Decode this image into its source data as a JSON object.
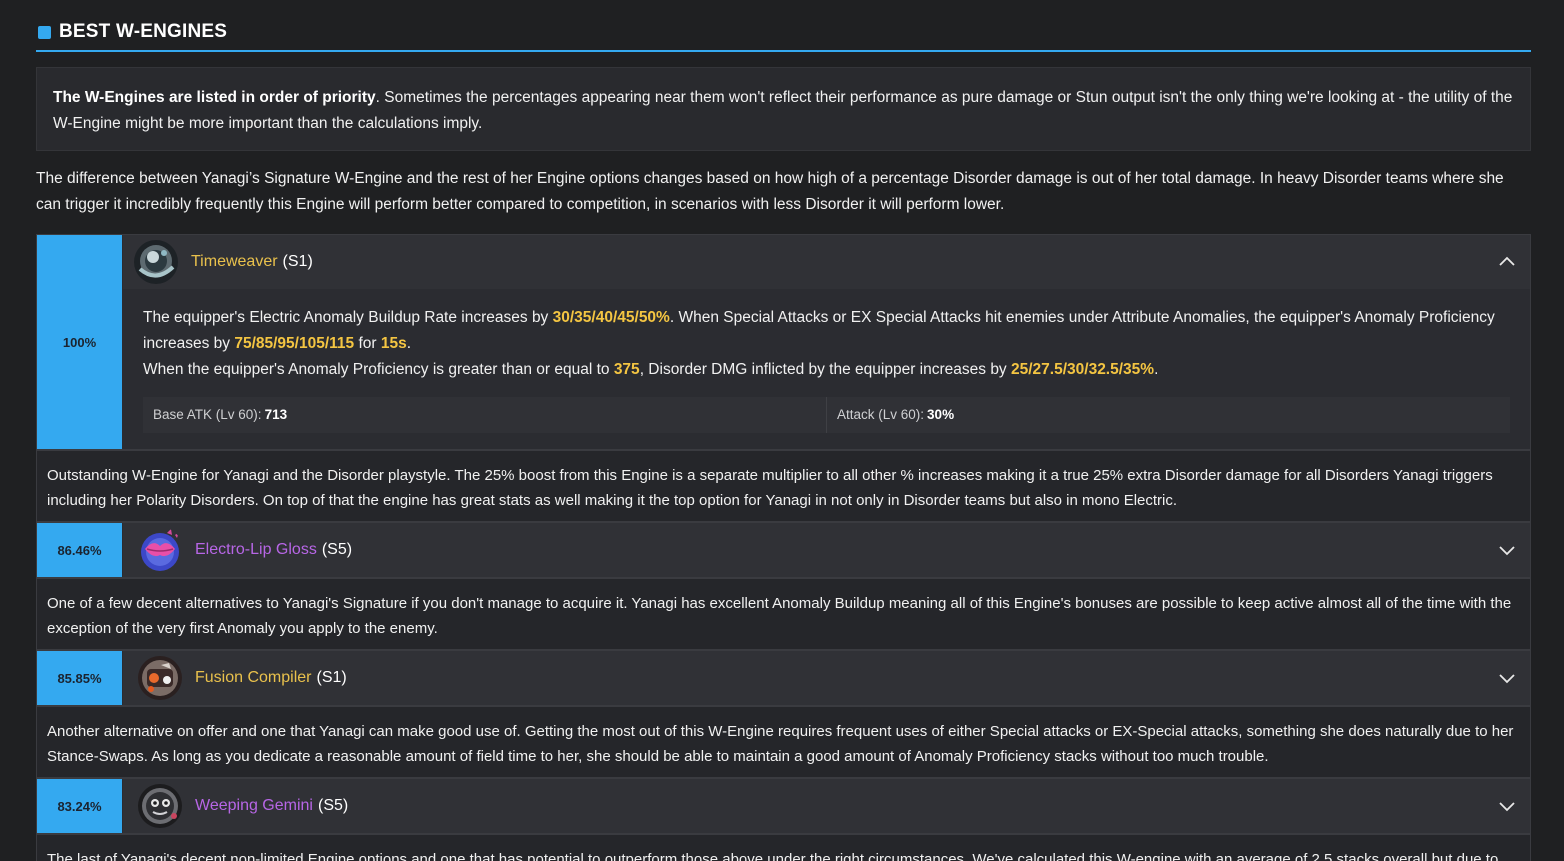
{
  "section": {
    "title": "BEST W-ENGINES",
    "accent": "#34a9f0"
  },
  "intro": {
    "bold": "The W-Engines are listed in order of priority",
    "rest": ". Sometimes the percentages appearing near them won't reflect their performance as pure damage or Stun output isn't the only thing we're looking at - the utility of the W-Engine might be more important than the calculations imply."
  },
  "paragraph": "The difference between Yanagi’s Signature W-Engine and the rest of her Engine options changes based on how high of a percentage Disorder damage is out of her total damage. In heavy Disorder teams where she can trigger it incredibly frequently this Engine will perform better compared to competition, in scenarios with less Disorder it will perform lower.",
  "engines": [
    {
      "percent": "100%",
      "name": "Timeweaver",
      "rank": "(S1)",
      "rarity_color": "#e9c14c",
      "icon": "timeweaver-icon",
      "expanded": true,
      "effect": {
        "l1a": "The equipper's Electric Anomaly Buildup Rate increases by ",
        "v1": "30/35/40/45/50%",
        "l1b": ". When Special Attacks or EX Special Attacks hit enemies under Attribute Anomalies, the equipper's Anomaly Proficiency increases by ",
        "v2": "75/85/95/105/115",
        "l1c": " for ",
        "v3": "15s",
        "l1d": ".",
        "l2a": "When the equipper's Anomaly Proficiency is greater than or equal to ",
        "v4": "375",
        "l2b": ", Disorder DMG inflicted by the equipper increases by ",
        "v5": "25/27.5/30/32.5/35%",
        "l2c": "."
      },
      "stats": [
        {
          "label": "Base ATK (Lv 60):",
          "value": "713"
        },
        {
          "label": "Attack (Lv 60):",
          "value": "30%"
        }
      ],
      "description": "Outstanding W-Engine for Yanagi and the Disorder playstyle. The 25% boost from this Engine is a separate multiplier to all other % increases making it a true 25% extra Disorder damage for all Disorders Yanagi triggers including her Polarity Disorders. On top of that the engine has great stats as well making it the top option for Yanagi in not only in Disorder teams but also in mono Electric."
    },
    {
      "percent": "86.46%",
      "name": "Electro-Lip Gloss",
      "rank": "(S5)",
      "rarity_color": "#b766e6",
      "icon": "electro-lip-gloss-icon",
      "expanded": false,
      "description": "One of a few decent alternatives to Yanagi's Signature if you don't manage to acquire it. Yanagi has excellent Anomaly Buildup meaning all of this Engine's bonuses are possible to keep active almost all of the time with the exception of the very first Anomaly you apply to the enemy."
    },
    {
      "percent": "85.85%",
      "name": "Fusion Compiler",
      "rank": "(S1)",
      "rarity_color": "#e9c14c",
      "icon": "fusion-compiler-icon",
      "expanded": false,
      "description": "Another alternative on offer and one that Yanagi can make good use of. Getting the most out of this W-Engine requires frequent uses of either Special attacks or EX-Special attacks, something she does naturally due to her Stance-Swaps. As long as you dedicate a reasonable amount of field time to her, she should be able to maintain a good amount of Anomaly Proficiency stacks without too much trouble."
    },
    {
      "percent": "83.24%",
      "name": "Weeping Gemini",
      "rank": "(S5)",
      "rarity_color": "#b766e6",
      "icon": "weeping-gemini-icon",
      "expanded": false,
      "description": "The last of Yanagi's decent non-limited Engine options and one that has potential to outperform those above under the right circumstances. We've calculated this W-engine with an average of 2.5 stacks overall but due to"
    }
  ]
}
